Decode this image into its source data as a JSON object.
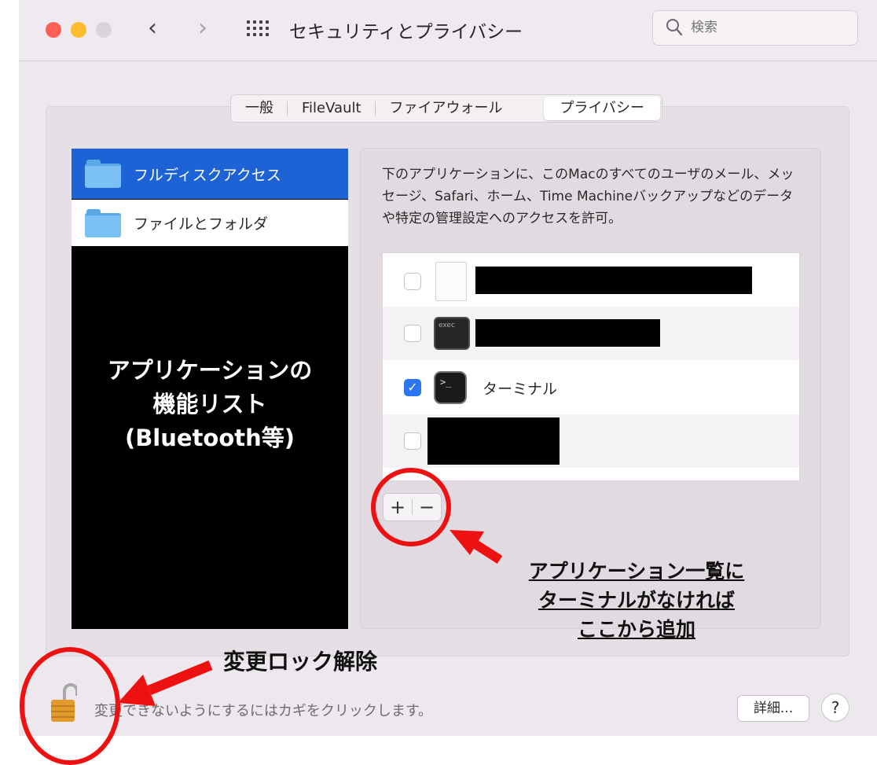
{
  "window": {
    "title": "セキュリティとプライバシー",
    "search_placeholder": "検索"
  },
  "tabs": [
    {
      "label": "一般"
    },
    {
      "label": "FileVault"
    },
    {
      "label": "ファイアウォール"
    },
    {
      "label": "プライバシー",
      "active": true
    }
  ],
  "sidebar": {
    "items": [
      {
        "label": "フルディスクアクセス",
        "selected": true
      },
      {
        "label": "ファイルとフォルダ"
      }
    ],
    "overlay_lines": [
      "アプリケーションの",
      "機能リスト",
      "(Bluetooth等)"
    ]
  },
  "main": {
    "description": "下のアプリケーションに、このMacのすべてのユーザのメール、メッセージ、Safari、ホーム、Time Machineバックアップなどのデータや特定の管理設定へのアクセスを許可。",
    "apps": [
      {
        "checked": false,
        "icon": "document-icon",
        "label": ""
      },
      {
        "checked": false,
        "icon": "exec-icon",
        "icon_text": "exec",
        "label": ""
      },
      {
        "checked": true,
        "icon": "terminal-icon",
        "icon_text": ">_",
        "label": "ターミナル"
      },
      {
        "checked": false,
        "icon": "",
        "label": ""
      }
    ],
    "add_label": "+",
    "remove_label": "−"
  },
  "footer": {
    "lock_text": "変更できないようにするにはカギをクリックします。",
    "detail_label": "詳細...",
    "help_label": "?"
  },
  "annotations": {
    "add_lines": [
      "アプリケーション一覧に",
      "ターミナルがなければ",
      "ここから追加"
    ],
    "lock_label": "変更ロック解除",
    "color": "#ee1111"
  }
}
